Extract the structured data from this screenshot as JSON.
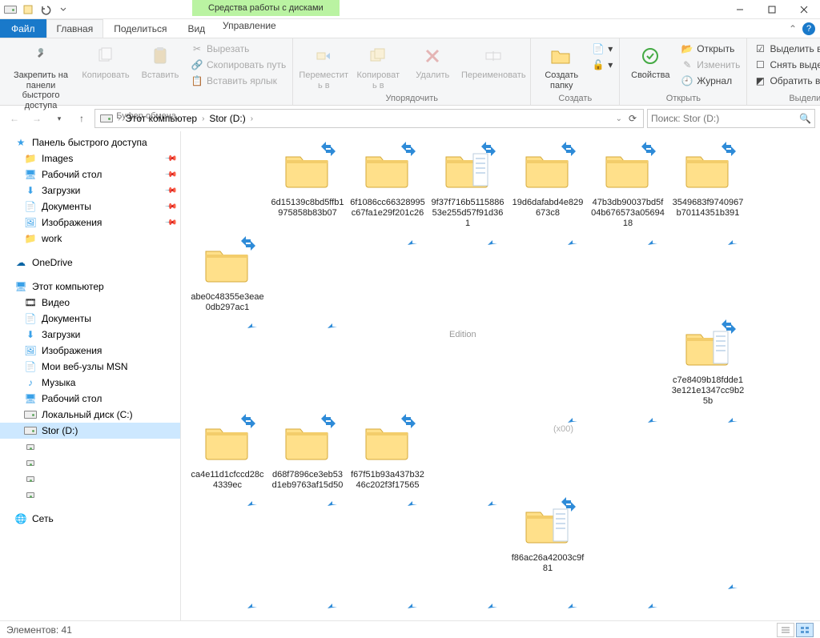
{
  "context_tab": "Средства работы с дисками",
  "tabs": {
    "file": "Файл",
    "home": "Главная",
    "share": "Поделиться",
    "view": "Вид",
    "manage": "Управление"
  },
  "ribbon": {
    "clipboard": {
      "label": "Буфер обмена",
      "pin": "Закрепить на панели\nбыстрого доступа",
      "copy": "Копировать",
      "paste": "Вставить",
      "cut": "Вырезать",
      "copy_path": "Скопировать путь",
      "paste_shortcut": "Вставить ярлык"
    },
    "organize": {
      "label": "Упорядочить",
      "move_to": "Переместит\nь в",
      "copy_to": "Копироват\nь в",
      "delete": "Удалить",
      "rename": "Переименовать"
    },
    "new": {
      "label": "Создать",
      "new_folder": "Создать\nпапку"
    },
    "open": {
      "label": "Открыть",
      "properties": "Свойства",
      "open": "Открыть",
      "edit": "Изменить",
      "history": "Журнал"
    },
    "select": {
      "label": "Выделить",
      "select_all": "Выделить все",
      "select_none": "Снять выделение",
      "invert": "Обратить выделение"
    }
  },
  "breadcrumb": {
    "root": "Этот компьютер",
    "current": "Stor (D:)"
  },
  "search_placeholder": "Поиск: Stor (D:)",
  "tree": {
    "quick_access": "Панель быстрого доступа",
    "images": "Images",
    "desktop": "Рабочий стол",
    "downloads": "Загрузки",
    "documents": "Документы",
    "pictures": "Изображения",
    "work": "work",
    "onedrive": "OneDrive",
    "this_pc": "Этот компьютер",
    "videos": "Видео",
    "documents2": "Документы",
    "downloads2": "Загрузки",
    "pictures2": "Изображения",
    "msn": "Мои веб-узлы MSN",
    "music": "Музыка",
    "desktop2": "Рабочий стол",
    "local_c": "Локальный диск (C:)",
    "stor_d": "Stor (D:)",
    "network": "Сеть"
  },
  "folders": [
    "6d15139c8bd5ffb1975858b83b07",
    "6f1086cc66328995c67fa1e29f201c26",
    "9f37f716b511588653e255d57f91d361",
    "19d6dafabd4e829673c8",
    "47b3db90037bd5f04b676573a0569418",
    "3549683f9740967b70114351b391",
    "abe0c48355e3eae0db297ac1",
    "",
    "",
    "",
    "",
    "c7e8409b18fdde13e121e1347cc9b25b",
    "ca4e11d1cfccd28c4339ec",
    "d68f7896ce3eb53d1eb9763af15d50",
    "f67f51b93a437b3246c202f3f17565",
    "f86ac26a42003c9f81"
  ],
  "partial_labels": {
    "edition": "Edition",
    "x00": "(x00)"
  },
  "status": {
    "count_label": "Элементов: 41"
  }
}
